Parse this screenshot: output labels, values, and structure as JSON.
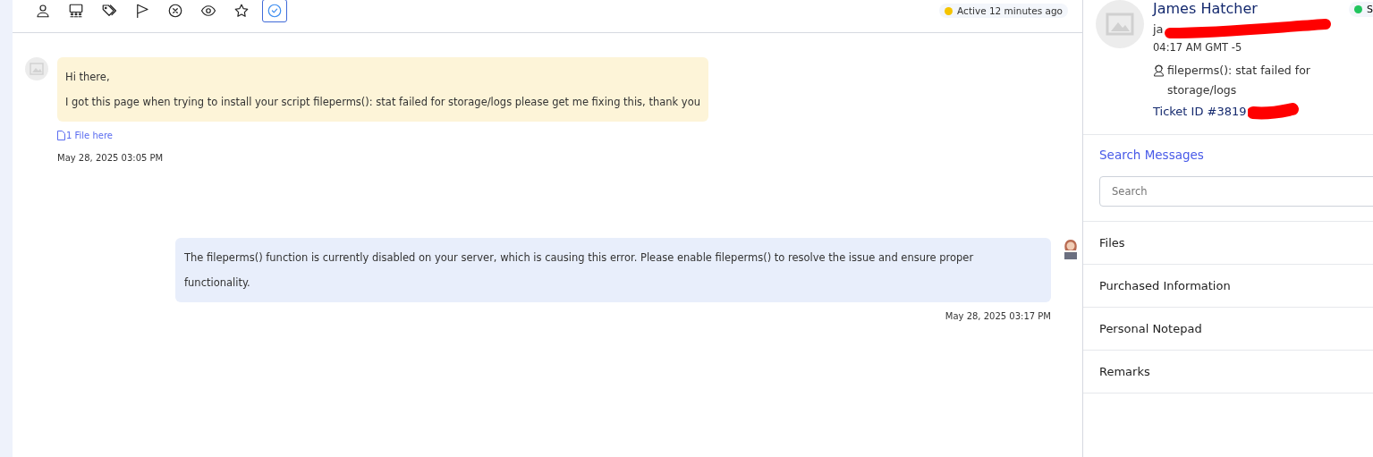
{
  "toolbar": [
    {
      "kind": "user",
      "selected": false
    },
    {
      "kind": "group",
      "selected": false
    },
    {
      "kind": "tags",
      "selected": false
    },
    {
      "kind": "flag",
      "selected": false
    },
    {
      "kind": "close",
      "selected": false
    },
    {
      "kind": "eye",
      "selected": false
    },
    {
      "kind": "star",
      "selected": false
    },
    {
      "kind": "check",
      "selected": true
    }
  ],
  "activity": {
    "text": "Active 12 minutes ago",
    "color": "#f5c400"
  },
  "messages": [
    {
      "kind": "incoming",
      "lines": [
        "Hi there,",
        "I got this page when trying to install your script fileperms(): stat failed for storage/logs please get me fixing this, thank you"
      ],
      "attachment": "1 File here",
      "time": "May 28, 2025 03:05 PM"
    },
    {
      "kind": "outgoing",
      "lines": [
        "The fileperms() function is currently disabled on your server, which is causing this error. Please enable fileperms() to resolve the issue and ensure proper functionality."
      ],
      "time": "May 28, 2025 03:17 PM"
    }
  ],
  "customer": {
    "name": "James Hatcher",
    "email": "ja",
    "local_time": "04:17 AM GMT -5",
    "subject": "fileperms(): stat failed for storage/logs",
    "ticket": "Ticket ID #3819",
    "status": {
      "text": "S",
      "color": "#22c55e"
    }
  },
  "search": {
    "title": "Search Messages",
    "placeholder": "Search"
  },
  "sections": [
    "Files",
    "Purchased Information",
    "Personal Notepad",
    "Remarks"
  ]
}
